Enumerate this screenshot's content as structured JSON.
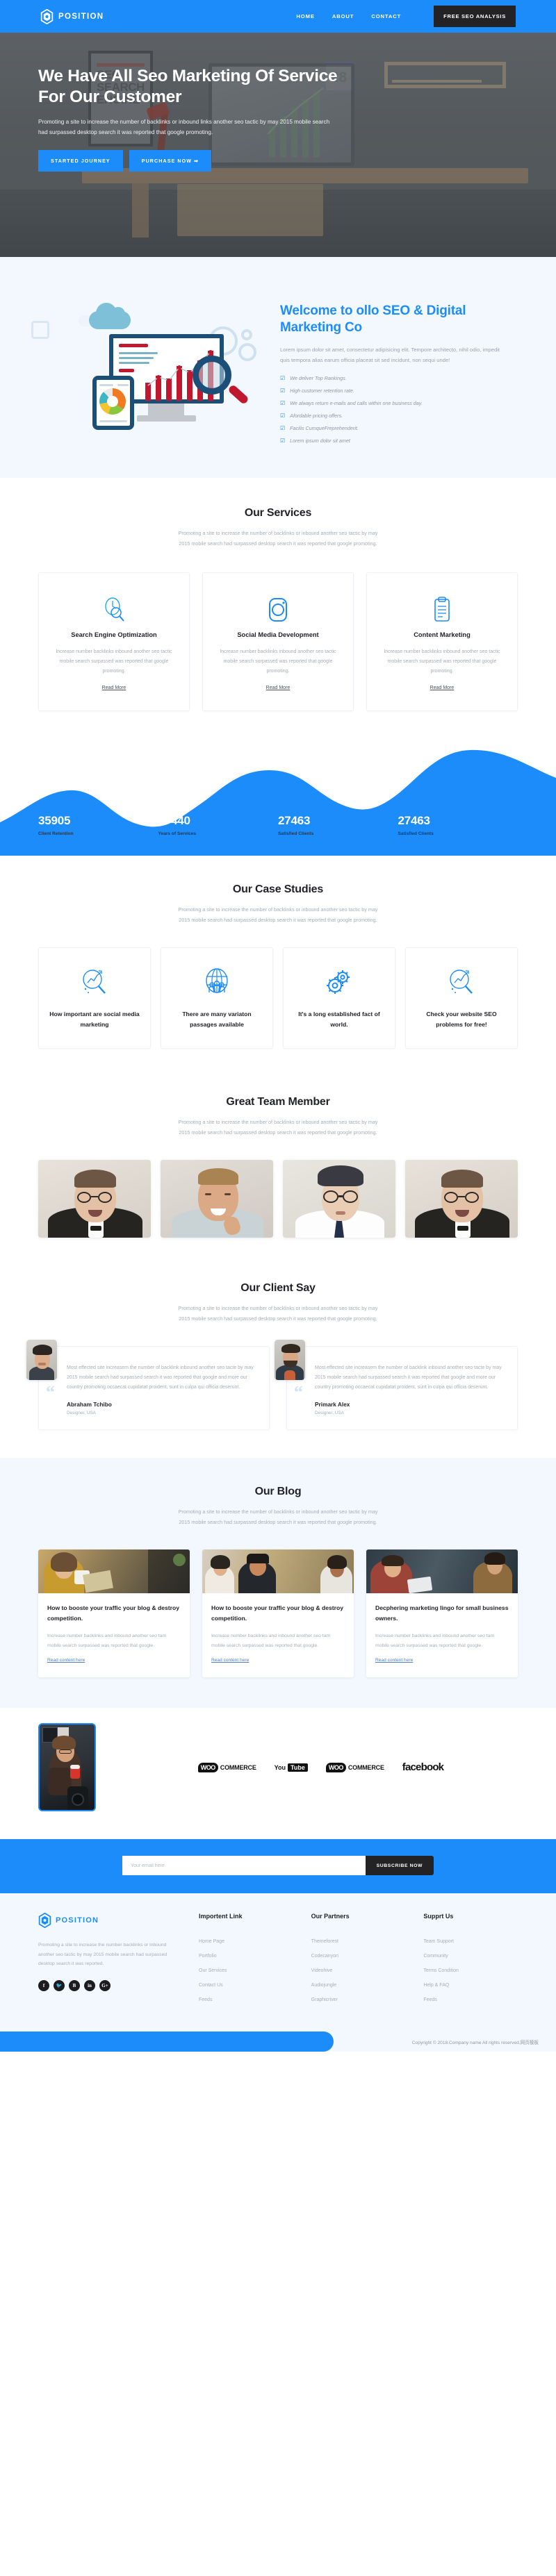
{
  "brand": {
    "name": "POSITION",
    "icon": "hexagon-logo-icon",
    "color": "#1d8cfb"
  },
  "header": {
    "nav": [
      {
        "label": "HOME"
      },
      {
        "label": "ABOUT"
      },
      {
        "label": "CONTACT"
      }
    ],
    "cta_label": "FREE SEO ANALYSIS"
  },
  "hero": {
    "title": "We Have All Seo Marketing Of Service For Our Customer",
    "subtitle": "Promoting a site to increase the number of backlinks or inbound links another seo tactic by may 2015 mobile search had surpassed desktop search it was reported that google promoting.",
    "btn_primary": "STARTED JOURNEY",
    "btn_secondary": "PURCHASE NOW ➡",
    "calendar_day": "28",
    "poster_text": "SEO SEARCH ENGINE"
  },
  "welcome": {
    "title": "Welcome to ollo SEO & Digital Marketing Co",
    "paragraph": "Lorem ipsum dolor sit amet, consectetur adipisicing elit. Tempore architecto, nihil odio, impedit quis tempora alias earum officia placeat sit sed incidunt, non sequi unde!",
    "features": [
      "We deliver Top Rankings.",
      "High customer retention rate.",
      "We always return e-mails and calls within one business day.",
      "Afordable pricing offers.",
      "Facilis CumqueFreprehenderit.",
      "Lorem ipsum dolor sit amet"
    ]
  },
  "common": {
    "section_sub": "Promoting a site to increase the number of backlinks or inbound another seo tactic by may 2015 mobile search had surpassed desktop search it was reported that google promoting.",
    "read_more": "Read More"
  },
  "services": {
    "title": "Our Services",
    "subtitle": "Promoting a site to increase the number of backlinks or inbound another seo tactic by may 2015 mobile search had surpassed desktop search it was reported that google promoting.",
    "cards": [
      {
        "icon": "seo-magnifier-icon",
        "name": "Search Engine Optimization",
        "desc": "Increase number backlinks inbound another seo tactic mobile search surpassed was reported that google promoting.",
        "link": "Read More"
      },
      {
        "icon": "instagram-camera-icon",
        "name": "Social Media Development",
        "desc": "Increase number backlinks inbound another seo tactic mobile search surpassed was reported that google promoting.",
        "link": "Read More"
      },
      {
        "icon": "clipboard-icon",
        "name": "Content Marketing",
        "desc": "Increase number backlinks inbound another seo tactic mobile search surpassed was reported that google promoting.",
        "link": "Read More"
      }
    ]
  },
  "counters": [
    {
      "value": "35905",
      "label": "Client Retention"
    },
    {
      "value": "37440",
      "label": "Years of Services"
    },
    {
      "value": "27463",
      "label": "Satisfied Clients"
    },
    {
      "value": "27463",
      "label": "Satisfied Clients"
    }
  ],
  "cases": {
    "title": "Our Case Studies",
    "subtitle": "Promoting a site to increase the number of backlinks or inbound another seo tactic by may 2015 mobile search had surpassed desktop search it was reported that google promoting.",
    "cards": [
      {
        "icon": "magnifier-analytics-icon",
        "title": "How important are social media marketing"
      },
      {
        "icon": "globe-people-icon",
        "title": "There are many variaton passages available"
      },
      {
        "icon": "gears-icon",
        "title": "It's a long established fact of world."
      },
      {
        "icon": "magnifier-analytics-icon",
        "title": "Check your website SEO problems for free!"
      }
    ]
  },
  "team": {
    "title": "Great Team Member",
    "subtitle": "Promoting a site to increase the number of backlinks or inbound another seo tactic by may 2015 mobile search had surpassed desktop search it was reported that google promoting.",
    "members": [
      {
        "photo": "team-member-photo-1"
      },
      {
        "photo": "team-member-photo-2"
      },
      {
        "photo": "team-member-photo-3"
      },
      {
        "photo": "team-member-photo-4"
      }
    ]
  },
  "testimonials": {
    "title": "Our Client Say",
    "subtitle": "Promoting a site to increase the number of backlinks or inbound another seo tactic by may 2015 mobile search had surpassed desktop search it was reported that google promoting.",
    "items": [
      {
        "text": "Most effected site increasem the number of backlink inbound another seo tacte by may 2015 mobile search had surpassed search it was reported that google and more our country promoting occaecat cupidatat proident, sunt in culpa qui officia deserunt.",
        "name": "Abraham Tchibo",
        "role": "Designer, USA"
      },
      {
        "text": "Most effected site increasem the number of backlink inbound another seo tacte by may 2015 mobile search had surpassed search it was reported that google and more our country promoting occaecat cupidatat proident, sunt in culpa qui officia deserunt.",
        "name": "Primark Alex",
        "role": "Designer, USA"
      }
    ]
  },
  "blog": {
    "title": "Our Blog",
    "subtitle": "Promoting a site to increase the number of backlinks or inbound another seo tactic by may 2015 mobile search had surpassed desktop search it was reported that google promoting.",
    "posts": [
      {
        "image": "blog-photo-woman-reading",
        "title": "How to booste your traffic your blog & destroy competition.",
        "desc": "Increase number backlinks and inbound another seo tam mobile search surpassed was reported that google.",
        "link": "Read content here"
      },
      {
        "image": "blog-photo-friends-cafe",
        "title": "How to booste your traffic your blog & destroy competition.",
        "desc": "Increase number backlinks and inbound another seo tam mobile search surpassed was reported that google.",
        "link": "Read content here"
      },
      {
        "image": "blog-photo-colleagues-meeting",
        "title": "Decphering marketing lingo for small business owners.",
        "desc": "Increase number backlinks and inbound another seo tam mobile search surpassed was reported that google.",
        "link": "Read content here"
      }
    ]
  },
  "brands": [
    {
      "name": "WooCommerce",
      "badge": "WOO",
      "word": "COMMERCE"
    },
    {
      "name": "YouTube",
      "badge": "You",
      "word": "Tube"
    },
    {
      "name": "WooCommerce",
      "badge": "WOO",
      "word": "COMMERCE"
    },
    {
      "name": "facebook",
      "badge": "",
      "word": "facebook"
    }
  ],
  "newsletter": {
    "placeholder": "Your email here",
    "value": "",
    "button": "SUBSCRIBE NOW"
  },
  "footer": {
    "about": "Promoting a site to increase the number backlinks or inbound another seo tactic by may 2015 mobile search had surpassed desktop search it was reported.",
    "socials": [
      {
        "icon": "facebook-icon",
        "glyph": "f"
      },
      {
        "icon": "twitter-icon",
        "glyph": "🐦"
      },
      {
        "icon": "behance-icon",
        "glyph": "B"
      },
      {
        "icon": "linkedin-icon",
        "glyph": "in"
      },
      {
        "icon": "google-plus-icon",
        "glyph": "G+"
      }
    ],
    "columns": [
      {
        "heading": "Importent Link",
        "links": [
          "Home Page",
          "Portfolio",
          "Our Services",
          "Contact Us",
          "Feeds"
        ]
      },
      {
        "heading": "Our Partners",
        "links": [
          "Themeforest",
          "Codecanyon",
          "Videohive",
          "Audiojungle",
          "Graphicriver"
        ]
      },
      {
        "heading": "Supprt Us",
        "links": [
          "Team Support",
          "Community",
          "Terms Condition",
          "Help & FAQ",
          "Feeds"
        ]
      }
    ],
    "copyright": "Copyright © 2018.Company name All rights reserved.网页模板"
  }
}
